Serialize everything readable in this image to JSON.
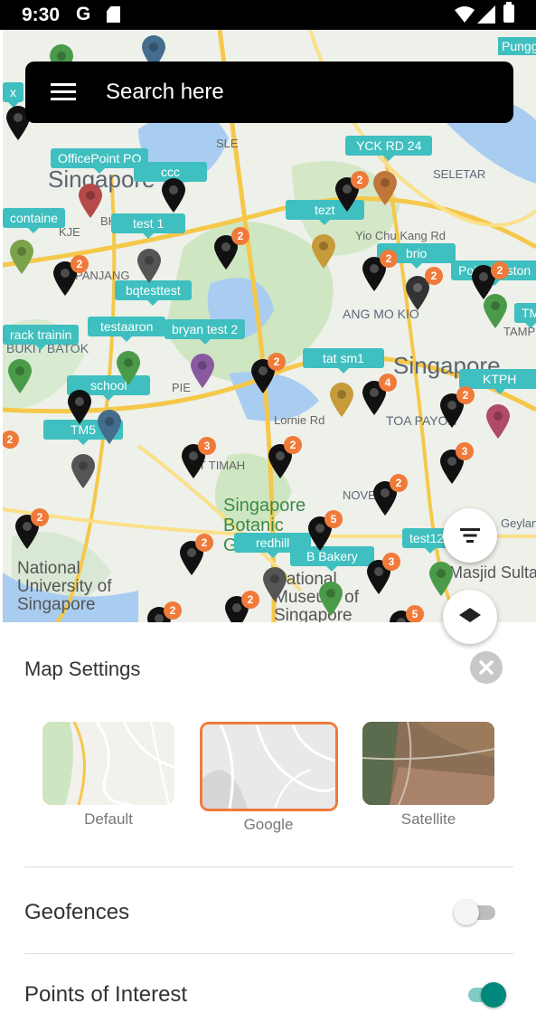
{
  "status_bar": {
    "time": "9:30",
    "g_icon": "G"
  },
  "search": {
    "placeholder": "Search here"
  },
  "map": {
    "area_labels": [
      "Singapore",
      "Singapore",
      "Punggol",
      "SELETAR",
      "ANG MO KIO",
      "BUKIT BATOK",
      "TOA PAYOH",
      "Singapore Botanic Gardens",
      "National University of Singapore",
      "National Museum of Singapore",
      "Masjid Sultan",
      "NOVENA",
      "Geylang",
      "KJE",
      "BKE",
      "PIE",
      "SLE",
      "Lornie Rd",
      "Yio Chu Kang Rd",
      "BT TIMAH",
      "ST PANJANG",
      "TAMPINES"
    ],
    "pin_tags": [
      "OfficePoint PO",
      "ccc",
      "test 1",
      "bqtesttest",
      "testaaron",
      "bryan test 2",
      "school",
      "TM5",
      "tezt",
      "YCK RD 24",
      "brio",
      "Point Custon",
      "TM",
      "tat sm1",
      "KTPH",
      "test123",
      "redhill",
      "B Bakery",
      "rack trainin",
      "containe",
      "x"
    ],
    "badge_counts": [
      "2",
      "2",
      "2",
      "2",
      "2",
      "2",
      "2",
      "4",
      "2",
      "3",
      "3",
      "2",
      "2",
      "2",
      "5",
      "2",
      "3",
      "2",
      "5",
      "2",
      "2"
    ]
  },
  "sheet": {
    "title": "Map Settings",
    "map_types": [
      {
        "label": "Default",
        "selected": false
      },
      {
        "label": "Google",
        "selected": true
      },
      {
        "label": "Satellite",
        "selected": false
      }
    ],
    "geofences": {
      "label": "Geofences",
      "on": false
    },
    "poi": {
      "label": "Points of Interest",
      "on": true
    }
  },
  "colors": {
    "accent": "#f07a3a",
    "tag": "#3fbfbf",
    "toggle_on": "#00897b",
    "toggle_on_track": "#80cbc4"
  }
}
